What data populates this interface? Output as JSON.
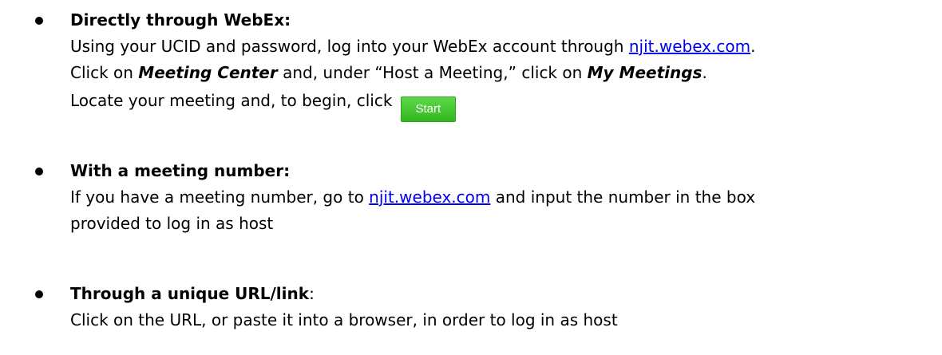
{
  "items": [
    {
      "heading": "Directly through WebEx:",
      "line1_a": "Using your UCID and password, log into your WebEx account through ",
      "line1_link": "njit.webex.com",
      "line1_b": ".",
      "line2_a": "Click on ",
      "line2_em1": "Meeting Center",
      "line2_b": " and, under “Host a Meeting,” click on ",
      "line2_em2": "My Meetings",
      "line2_c": ".",
      "line3_a": "Locate your meeting and, to begin, click",
      "start_label": "Start"
    },
    {
      "heading": "With a meeting number:",
      "line1_a": "If you have a meeting number, go to ",
      "line1_link": "njit.webex.com",
      "line1_b": " and input the number in the box",
      "line2": "provided to log in as host"
    },
    {
      "heading": "Through a unique URL/link",
      "heading_suffix": ":",
      "line1": "Click on the URL, or paste it into a browser, in order to log in as host"
    }
  ],
  "colors": {
    "link": "#0000ee",
    "start_button": "#3cc62a"
  }
}
